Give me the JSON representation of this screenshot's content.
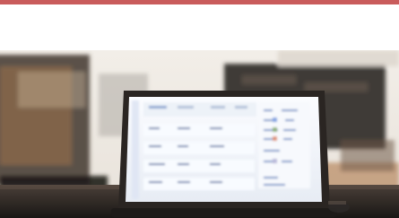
{
  "header": {
    "rule_color": "#c95c5c"
  },
  "photo": {
    "subject": "laptop-with-dashboard-on-desk",
    "palette": {
      "wall": "#ece7e0",
      "shelf": "#3d3733",
      "wood": "#8f6b4b",
      "desk": "#2a2522",
      "screen": "#f3f6fb",
      "bezel": "#24211f",
      "accent": "#4f72b8"
    }
  }
}
